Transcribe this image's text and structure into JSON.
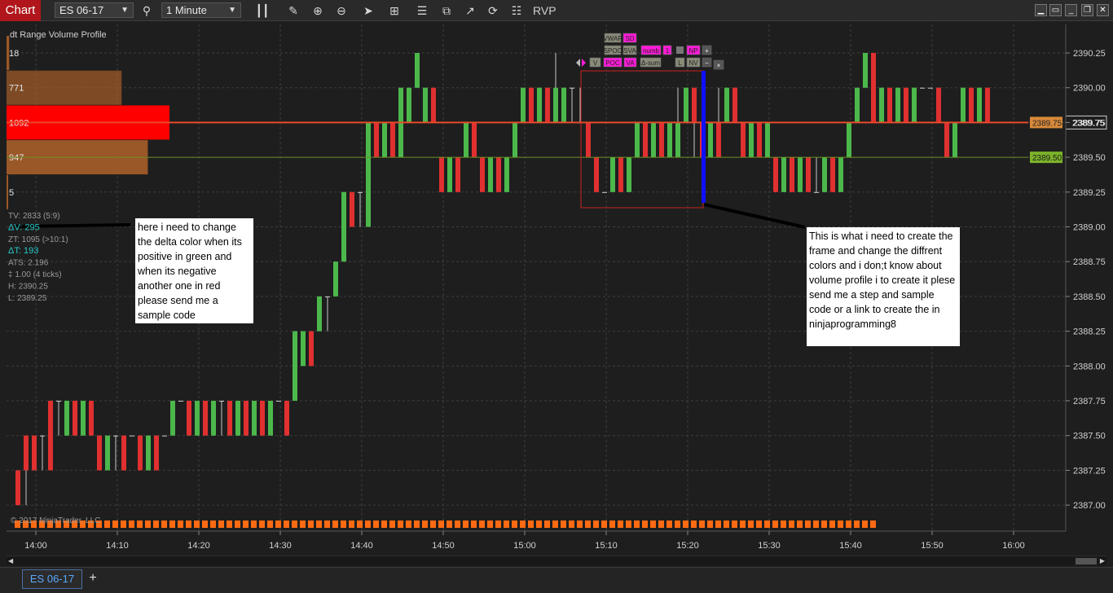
{
  "toolbar": {
    "chart_label": "Chart",
    "instrument": "ES 06-17",
    "interval": "1 Minute",
    "rvp_label": "RVP",
    "icons": [
      "search-icon",
      "bar-type-icon",
      "pencil-icon",
      "zoom-in-icon",
      "zoom-out-icon",
      "pointer-icon",
      "data-box-icon",
      "indicators-icon",
      "strategies-icon",
      "drawing-tools-icon",
      "reload-icon",
      "properties-icon"
    ],
    "window_buttons": [
      "minimize",
      "restore",
      "maximize",
      "close"
    ]
  },
  "chart": {
    "indicator_title": "dt Range Volume Profile",
    "copyright": "© 2017 NinjaTrader, LLC",
    "price_labels": [
      "2390.25",
      "2390.00",
      "2389.75",
      "2389.50",
      "2389.25",
      "2389.00",
      "2388.75",
      "2388.50",
      "2388.25",
      "2388.00",
      "2387.75",
      "2387.50",
      "2387.25",
      "2387.00"
    ],
    "time_labels": [
      "14:00",
      "14:10",
      "14:20",
      "14:30",
      "14:40",
      "14:50",
      "15:00",
      "15:10",
      "15:20",
      "15:30",
      "15:40",
      "15:50",
      "16:00"
    ],
    "markers": {
      "last_price": "2389.75",
      "orange_marker": "2389.75",
      "green_marker": "2389.50"
    },
    "volume_profile": [
      {
        "price": "2390.25",
        "label": "18",
        "volume": 18
      },
      {
        "price": "2390.00",
        "label": "771",
        "volume": 771
      },
      {
        "price": "2389.75",
        "label": "1092",
        "volume": 1092,
        "poc": true
      },
      {
        "price": "2389.50",
        "label": "947",
        "volume": 947
      },
      {
        "price": "2389.25",
        "label": "5",
        "volume": 5
      }
    ],
    "stats": {
      "tv": "TV: 2833 (5:9)",
      "dv": "ΔV: 295",
      "zt": "ZT: 1095 (>10:1)",
      "dt": "ΔT: 193",
      "ats": "ATS: 2.196",
      "range": "‡ 1.00 (4 ticks)",
      "high": "H: 2390.25",
      "low": "L: 2389.25"
    },
    "rvp_buttons": {
      "row1": [
        "VWAP",
        "SD"
      ],
      "row2": [
        "SPOC",
        "SVA",
        "numb",
        "1",
        "NP",
        "+"
      ],
      "row3": [
        "V",
        "POC",
        "VA",
        "Δ-sum",
        "L",
        "NV",
        "−",
        "×"
      ]
    },
    "colors": {
      "up": "#4cb84c",
      "down": "#e03030",
      "poc": "#ff0000",
      "vp": "#b0622a",
      "price_line": "#e84a2a",
      "frame": "#cc2222",
      "edge": "#1010ff",
      "stats_accent": "#28c8c8"
    }
  },
  "notes": {
    "left": "here i need to change the delta color when its positive in green and when its negative another one in red please send me a sample code",
    "right": "This is what i need to create the frame and change the diffrent colors and i don;t know about volume profile i to create it plese send me a step and sample code or a link to create the in ninjaprogramming8"
  },
  "bottom": {
    "tab_label": "ES 06-17",
    "add_label": "+"
  }
}
